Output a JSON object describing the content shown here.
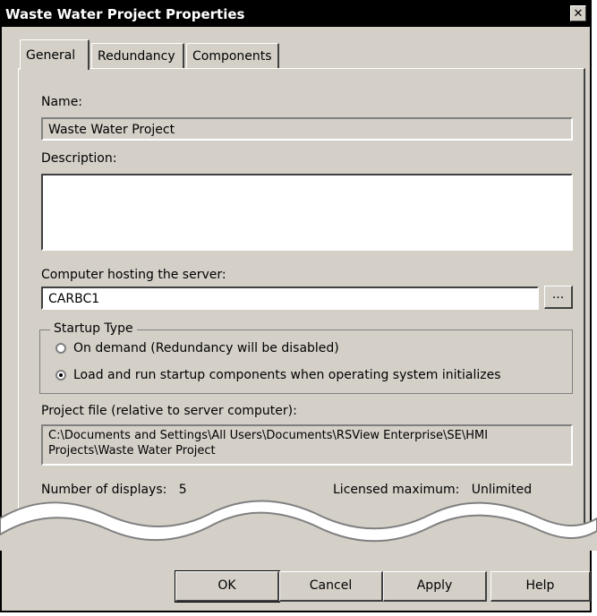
{
  "window": {
    "title": "Waste Water Project Properties",
    "close_glyph": "✕"
  },
  "tabs": [
    {
      "label": "General",
      "active": true
    },
    {
      "label": "Redundancy",
      "active": false
    },
    {
      "label": "Components",
      "active": false
    }
  ],
  "general": {
    "name_label": "Name:",
    "name_value": "Waste Water Project",
    "description_label": "Description:",
    "description_value": "",
    "host_label": "Computer hosting the server:",
    "host_value": "CARBC1",
    "browse_label": "...",
    "startup": {
      "legend": "Startup Type",
      "options": [
        {
          "label": "On demand (Redundancy will be disabled)",
          "checked": false
        },
        {
          "label": "Load and run startup components when operating system initializes",
          "checked": true
        }
      ]
    },
    "project_file_label": "Project file (relative to server computer):",
    "project_file_line1": "C:\\Documents and Settings\\All Users\\Documents\\RSView Enterprise\\SE\\HMI",
    "project_file_line2": "Projects\\Waste Water Project",
    "displays_label": "Number of displays:",
    "displays_value": "5",
    "licensed_label": "Licensed maximum:",
    "licensed_value": "Unlimited"
  },
  "buttons": {
    "ok": "OK",
    "cancel": "Cancel",
    "apply": "Apply",
    "help": "Help"
  },
  "colors": {
    "dialog_bg": "#d4d0c8",
    "titlebar_bg": "#000000",
    "field_bg": "#ffffff"
  }
}
